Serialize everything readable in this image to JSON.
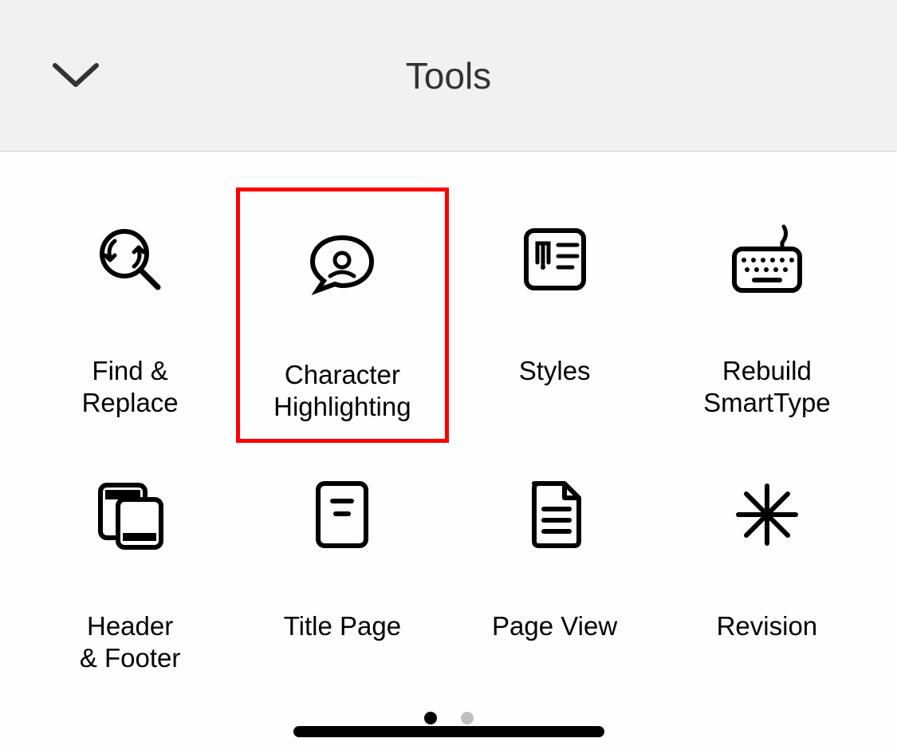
{
  "header": {
    "title": "Tools"
  },
  "tools": [
    {
      "label": "Find &\nReplace",
      "icon": "find-replace-icon",
      "highlighted": false
    },
    {
      "label": "Character\nHighlighting",
      "icon": "character-highlighting-icon",
      "highlighted": true
    },
    {
      "label": "Styles",
      "icon": "styles-icon",
      "highlighted": false
    },
    {
      "label": "Rebuild\nSmartType",
      "icon": "rebuild-smarttype-icon",
      "highlighted": false
    },
    {
      "label": "Header\n& Footer",
      "icon": "header-footer-icon",
      "highlighted": false
    },
    {
      "label": "Title Page",
      "icon": "title-page-icon",
      "highlighted": false
    },
    {
      "label": "Page View",
      "icon": "page-view-icon",
      "highlighted": false
    },
    {
      "label": "Revision",
      "icon": "revision-icon",
      "highlighted": false
    }
  ],
  "pagination": {
    "dots": 2,
    "active": 0
  }
}
